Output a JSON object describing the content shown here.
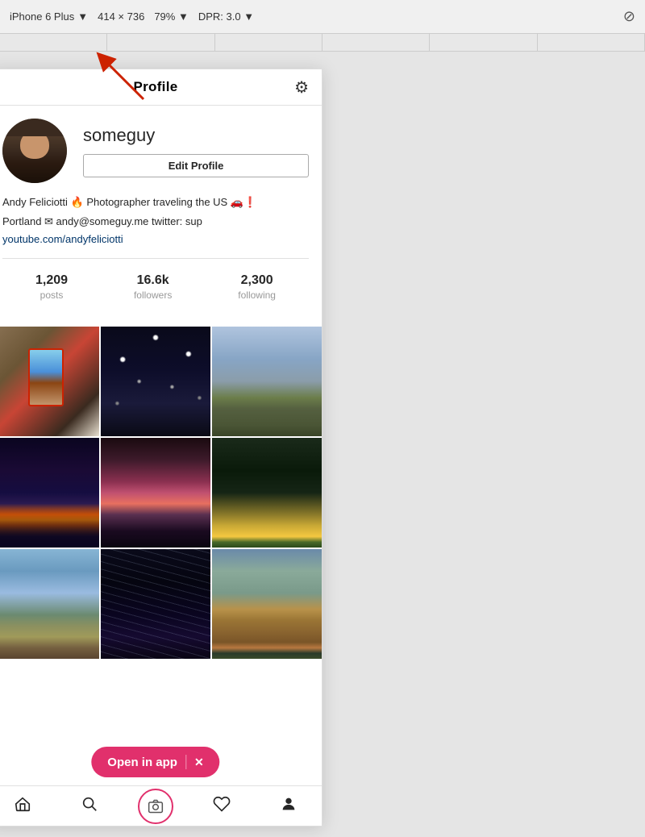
{
  "browser": {
    "device_label": "iPhone 6 Plus",
    "dropdown_arrow": "▼",
    "dimensions": "414 × 736",
    "zoom": "79%",
    "dpr": "DPR: 3.0",
    "rotate_icon": "⊘"
  },
  "instagram": {
    "header": {
      "title": "Profile",
      "settings_icon": "⚙"
    },
    "profile": {
      "username": "someguy",
      "edit_profile_label": "Edit Profile",
      "bio_line1": "Andy Feliciotti 🔥 Photographer traveling the US 🚗❗",
      "bio_line2": "Portland ✉ andy@someguy.me twitter: sup",
      "bio_link": "youtube.com/andyfeliciotti"
    },
    "stats": [
      {
        "value": "1,209",
        "label": "posts"
      },
      {
        "value": "16.6k",
        "label": "followers"
      },
      {
        "value": "2,300",
        "label": "following"
      }
    ],
    "open_in_app": {
      "label": "Open in app",
      "close": "✕"
    },
    "nav": {
      "home_icon": "🏠",
      "search_icon": "🔍",
      "camera_icon": "📷",
      "heart_icon": "♡",
      "profile_icon": "👤"
    }
  }
}
